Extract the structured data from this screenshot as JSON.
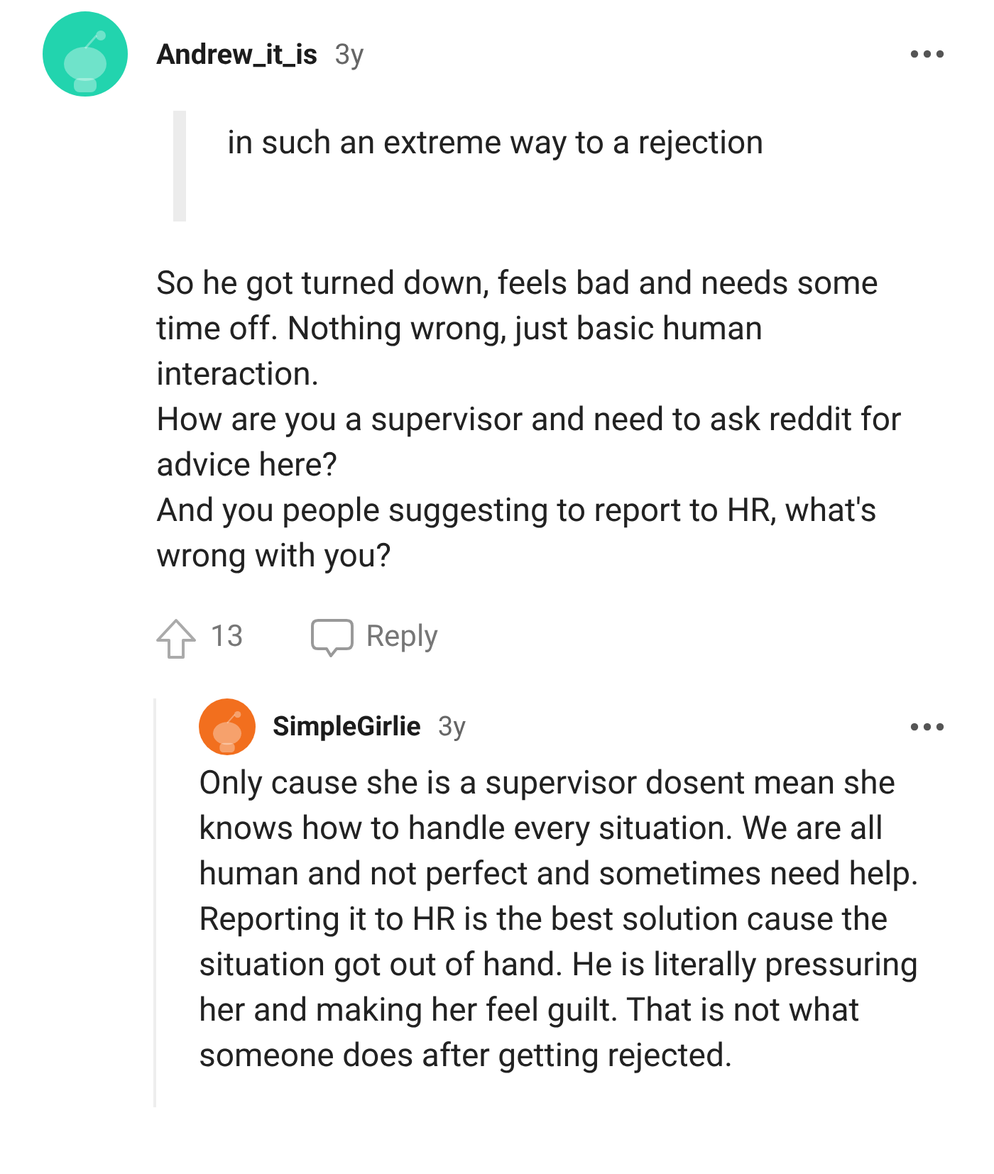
{
  "comment": {
    "author": "Andrew_it_is",
    "age": "3y",
    "color": "#22d4ae",
    "quote": "in such an extreme way to a rejection",
    "paragraphs": [
      "So he got turned down, feels bad and needs some time off. Nothing wrong, just basic human interaction.",
      "How are you a supervisor and need to ask reddit for advice here?",
      "And you people suggesting to report to HR, what's wrong with you?"
    ],
    "votes": "13",
    "reply_label": "Reply",
    "replies": [
      {
        "author": "SimpleGirlie",
        "age": "3y",
        "color": "#f26f1e",
        "text": "Only cause she is a supervisor dosent mean she knows how to handle every situation. We are all human and not perfect and sometimes need help. Reporting it to HR is the best solution cause the situation got out of hand. He is literally pressuring her and making her feel guilt. That is not what someone does after getting rejected."
      }
    ]
  }
}
